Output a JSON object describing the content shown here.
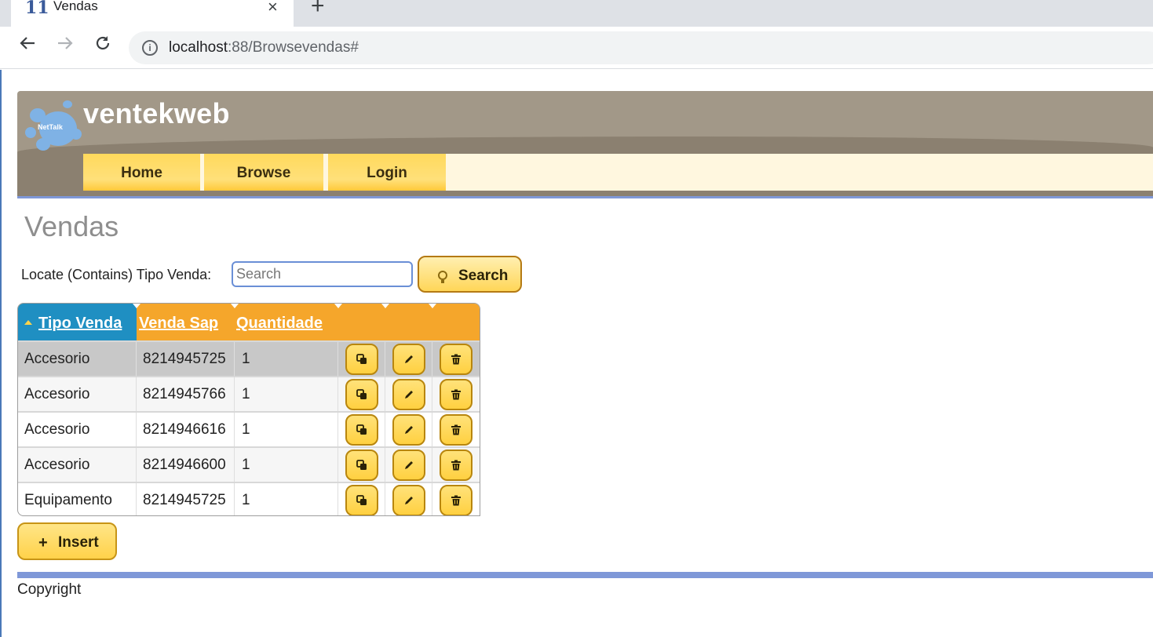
{
  "browser": {
    "tab_title": "Vendas",
    "tab_favicon": "11",
    "tab_close": "×",
    "new_tab": "+",
    "url_host": "localhost",
    "url_path": ":88/Browsevendas#",
    "back_icon": "arrow-left-icon",
    "forward_icon": "arrow-right-icon",
    "reload_icon": "reload-icon",
    "info_icon": "info-icon"
  },
  "header": {
    "logo_text": "NetTalk",
    "site_name": "ventekweb",
    "menu": [
      "Home",
      "Browse",
      "Login"
    ]
  },
  "page": {
    "title": "Vendas",
    "locate_label": "Locate (Contains) Tipo Venda:",
    "search_placeholder": "Search",
    "search_button": "Search",
    "insert_button": "Insert",
    "copyright": "Copyright"
  },
  "table": {
    "columns": [
      "Tipo Venda",
      "Venda Sap",
      "Quantidade"
    ],
    "sorted_column": "Tipo Venda",
    "rows": [
      {
        "tipo": "Accesorio",
        "sap": "8214945725",
        "qtd": "1"
      },
      {
        "tipo": "Accesorio",
        "sap": "8214945766",
        "qtd": "1"
      },
      {
        "tipo": "Accesorio",
        "sap": "8214946616",
        "qtd": "1"
      },
      {
        "tipo": "Accesorio",
        "sap": "8214946600",
        "qtd": "1"
      },
      {
        "tipo": "Equipamento",
        "sap": "8214945725",
        "qtd": "1"
      }
    ],
    "row_actions": [
      "copy-icon",
      "pencil-icon",
      "trash-icon"
    ]
  },
  "colors": {
    "header_bg": "#a29888",
    "menu_bg": "#fff7df",
    "button_yellow": "#ffd658",
    "table_head_orange": "#f5a62b",
    "table_head_sorted_blue": "#1f8fc2",
    "accent_bar": "#7f98d8"
  }
}
